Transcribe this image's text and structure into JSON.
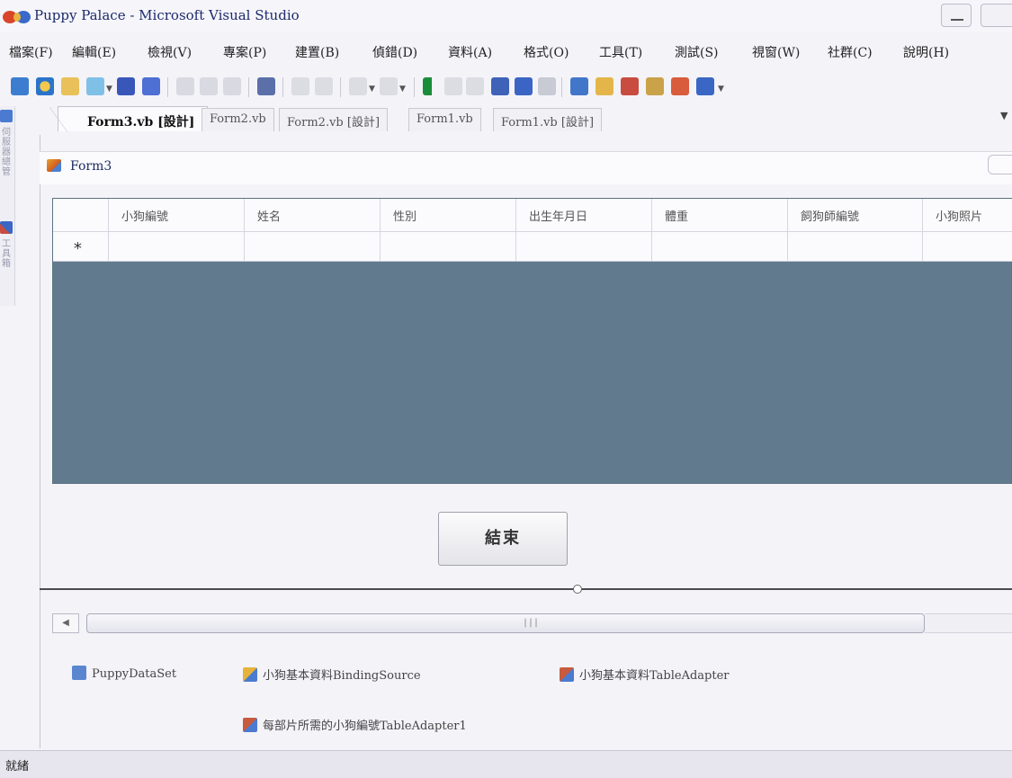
{
  "window": {
    "title": "Puppy Palace - Microsoft Visual Studio"
  },
  "menu": {
    "items": [
      "檔案(F)",
      "編輯(E)",
      "檢視(V)",
      "專案(P)",
      "建置(B)",
      "偵錯(D)",
      "資料(A)",
      "格式(O)",
      "工具(T)",
      "測試(S)",
      "視窗(W)",
      "社群(C)",
      "說明(H)"
    ]
  },
  "tabs": {
    "active": "Form3.vb [設計]",
    "items": [
      "Form2.vb",
      "Form2.vb [設計]",
      "Form1.vb",
      "Form1.vb [設計]"
    ]
  },
  "left_strip": {
    "labels": [
      "伺服器總管",
      "工具箱"
    ]
  },
  "form": {
    "title": "Form3"
  },
  "grid": {
    "columns": [
      "小狗編號",
      "姓名",
      "性別",
      "出生年月日",
      "體重",
      "飼狗師編號",
      "小狗照片"
    ],
    "new_row_marker": "*"
  },
  "buttons": {
    "end": "結束"
  },
  "tray": {
    "dataset": "PuppyDataSet",
    "binding_source": "小狗基本資料BindingSource",
    "table_adapter": "小狗基本資料TableAdapter",
    "table_adapter2": "每部片所需的小狗編號TableAdapter1"
  },
  "status": {
    "text": "就緒"
  },
  "colors": {
    "grid_background": "#617a8e",
    "title_text": "#1b2a6b"
  }
}
